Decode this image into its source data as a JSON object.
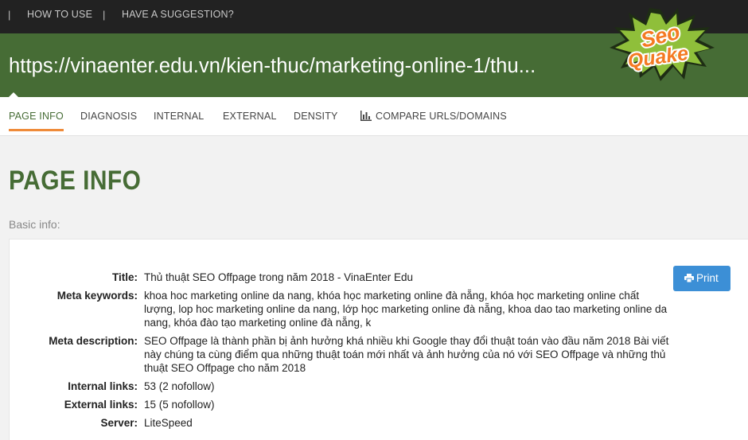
{
  "topnav": {
    "separator": "|",
    "how_to_use": "HOW TO USE",
    "suggestion": "HAVE A SUGGESTION?"
  },
  "url": "https://vinaenter.edu.vn/kien-thuc/marketing-online-1/thu...",
  "logo": {
    "line1": "Seo",
    "line2": "Quake"
  },
  "tabs": [
    {
      "label": "PAGE INFO",
      "active": true
    },
    {
      "label": "DIAGNOSIS"
    },
    {
      "label": "INTERNAL"
    },
    {
      "label": "EXTERNAL"
    },
    {
      "label": "DENSITY"
    },
    {
      "label": "COMPARE URLS/DOMAINS",
      "icon": "bar-chart-icon"
    }
  ],
  "page_title": "PAGE INFO",
  "section_label": "Basic info:",
  "print_label": "Print",
  "info": {
    "title": {
      "label": "Title:",
      "value": "Thủ thuật SEO Offpage trong năm 2018 - VinaEnter Edu"
    },
    "meta_keywords": {
      "label": "Meta keywords:",
      "value": "khoa hoc marketing online da nang, khóa học marketing online đà nẵng, khóa học marketing online chất lượng, lop hoc marketing online da nang, lớp học marketing online đà nẵng, khoa dao tao marketing online da nang, khóa đào tạo marketing online đà nẵng, k"
    },
    "meta_description": {
      "label": "Meta description:",
      "value": "SEO Offpage là thành phần bị ảnh hưởng khá nhiều khi Google thay đổi thuật toán vào đầu năm 2018 Bài viết này chúng ta cùng điểm qua những thuật toán mới nhất và ảnh hưởng của nó với SEO Offpage và những thủ thuật SEO Offpage cho năm 2018"
    },
    "internal_links": {
      "label": "Internal links:",
      "value": "53 (2 nofollow)"
    },
    "external_links": {
      "label": "External links:",
      "value": "15 (5 nofollow)"
    },
    "server": {
      "label": "Server:",
      "value": "LiteSpeed"
    }
  },
  "colors": {
    "brand_green": "#466c35",
    "accent_orange": "#ef8b3a",
    "print_blue": "#3c8fd6"
  }
}
